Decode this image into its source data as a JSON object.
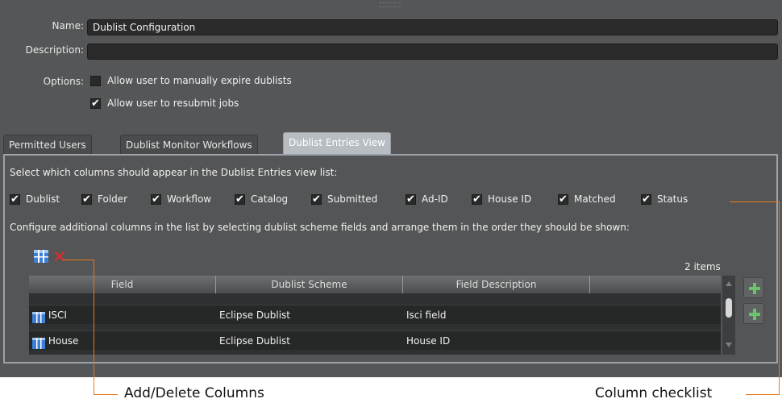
{
  "form": {
    "name_label": "Name:",
    "name_value": "Dublist Configuration",
    "description_label": "Description:",
    "description_value": "",
    "options_label": "Options:",
    "options": [
      {
        "label": "Allow user to manually expire dublists",
        "checked": false
      },
      {
        "label": "Allow user to resubmit jobs",
        "checked": true
      }
    ]
  },
  "tabs": [
    {
      "label": "Permitted Users",
      "active": false
    },
    {
      "label": "Dublist Monitor Workflows",
      "active": false
    },
    {
      "label": "Dublist Entries View",
      "active": true
    }
  ],
  "entries_view": {
    "instruction1": "Select which columns should appear in the Dublist Entries view list:",
    "columns": [
      {
        "label": "Dublist",
        "checked": true
      },
      {
        "label": "Folder",
        "checked": true
      },
      {
        "label": "Workflow",
        "checked": true
      },
      {
        "label": "Catalog",
        "checked": true
      },
      {
        "label": "Submitted",
        "checked": true
      },
      {
        "label": "Ad-ID",
        "checked": true
      },
      {
        "label": "House ID",
        "checked": true
      },
      {
        "label": "Matched",
        "checked": true
      },
      {
        "label": "Status",
        "checked": true
      }
    ],
    "instruction2": "Configure additional columns in the list by selecting dublist scheme fields and arrange them in the order they should be shown:",
    "item_count": "2 items",
    "grid_headers": [
      "Field",
      "Dublist Scheme",
      "Field Description",
      ""
    ],
    "rows": [
      {
        "field": "ISCI",
        "scheme": "Eclipse Dublist",
        "description": "Isci field"
      },
      {
        "field": "House",
        "scheme": "Eclipse Dublist",
        "description": "House ID"
      }
    ]
  },
  "icons": {
    "add_column": "add-column-icon",
    "delete_column": "delete-icon",
    "row_field": "column-field-icon",
    "move_up": "green-plus-icon",
    "move_down": "green-plus-icon"
  },
  "colors": {
    "panel_bg": "#555657",
    "active_tab": "#b8bdc2",
    "callout_line": "#e87a1a",
    "field_icon_blue": "#3b7fd6",
    "move_button_green": "#6ac26a"
  },
  "annotations": {
    "add_delete": "Add/Delete Columns",
    "column_checklist": "Column checklist"
  }
}
